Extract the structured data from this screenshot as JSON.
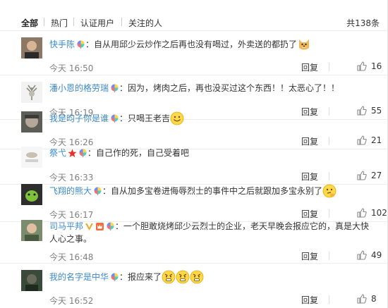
{
  "tabs": {
    "all": "全部",
    "hot": "热门",
    "verified": "认证用户",
    "following": "关注的人"
  },
  "total": "共138条",
  "reply_label": "回复",
  "comments": [
    {
      "user": "快手陈",
      "text": "：自从用邱少云炒作之后再也没有喝过，外卖送的都扔了",
      "time": "今天 16:50",
      "likes": "16"
    },
    {
      "user": "潘小恩的格劳瑞",
      "text": "：因为，烤肉之后，再也没买过这个东西！！太恶心了！！",
      "time": "今天 16:19",
      "likes": "55"
    },
    {
      "user": "我是昀子你是谁",
      "text": "：只喝王老吉",
      "time": "今天 16:26",
      "likes": "21"
    },
    {
      "user": "祭弋",
      "text": "：自己作的死，自己受着吧",
      "time": "今天 16:33",
      "likes": "27"
    },
    {
      "user": "飞翔的熊大",
      "text": "：自从加多宝卷进侮辱烈士的事件中之后就跟加多宝永别了",
      "time": "今天 16:17",
      "likes": "102"
    },
    {
      "user": "司马平邦",
      "text": "：一个胆敢烧烤邱少云烈士的企业，老天早晚会报应它的，真是大快",
      "text2": "人心之事。",
      "time": "今天 16:48",
      "likes": "49"
    },
    {
      "user": "我的名字是中华",
      "text": "：报应来了",
      "time": "今天 16:52",
      "likes": "8"
    }
  ]
}
